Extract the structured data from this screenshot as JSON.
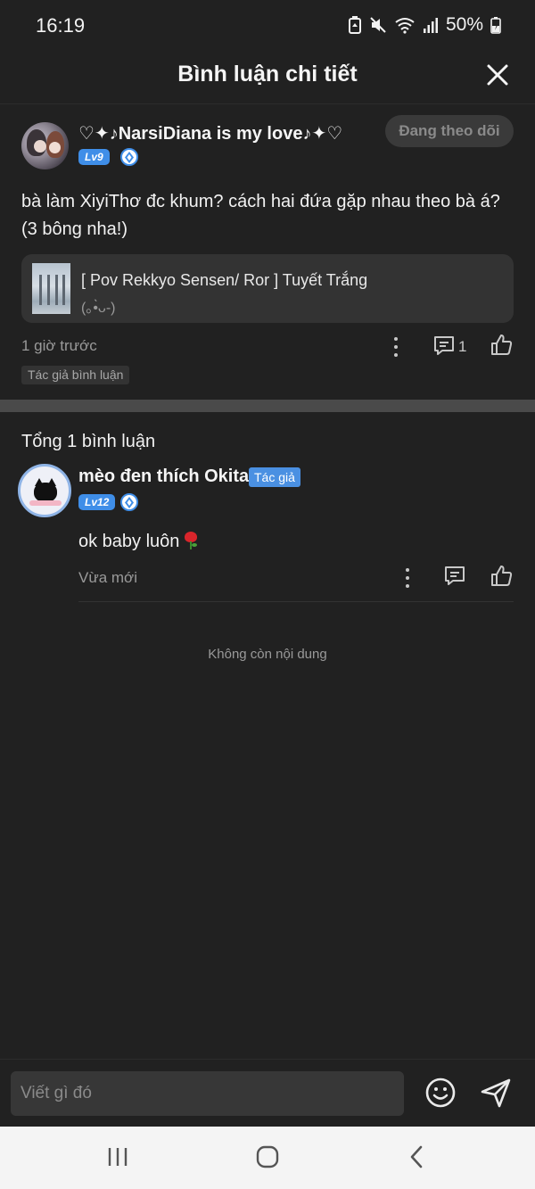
{
  "status": {
    "time": "16:19",
    "battery": "50%"
  },
  "header": {
    "title": "Bình luận chi tiết",
    "close_icon": "close-icon"
  },
  "main_comment": {
    "username": "♡✦♪NarsiDiana is my love♪✦♡",
    "level": "Lv9",
    "follow_label": "Đang theo dõi",
    "text": "bà làm XiyiThơ đc khum? cách hai đứa gặp nhau theo bà á? (3 bông nha!)",
    "story": {
      "title": "[ Pov Rekkyo Sensen/ Ror ] Tuyết Trắng",
      "subtitle": "(｡•̀ᴗ-)"
    },
    "time": "1 giờ trước",
    "reply_count": "1",
    "tag": "Tác giả bình luận"
  },
  "replies": {
    "total_label": "Tổng 1 bình luận",
    "items": [
      {
        "username": "mèo đen thích Okita",
        "author_label": "Tác giả",
        "level": "Lv12",
        "text": "ok baby luôn",
        "time": "Vừa mới"
      }
    ],
    "end_label": "Không còn nội dung"
  },
  "input": {
    "placeholder": "Viết gì đó"
  },
  "colors": {
    "background": "#212121",
    "accent_blue": "#3f8ee8",
    "divider": "#4a4a4a"
  }
}
